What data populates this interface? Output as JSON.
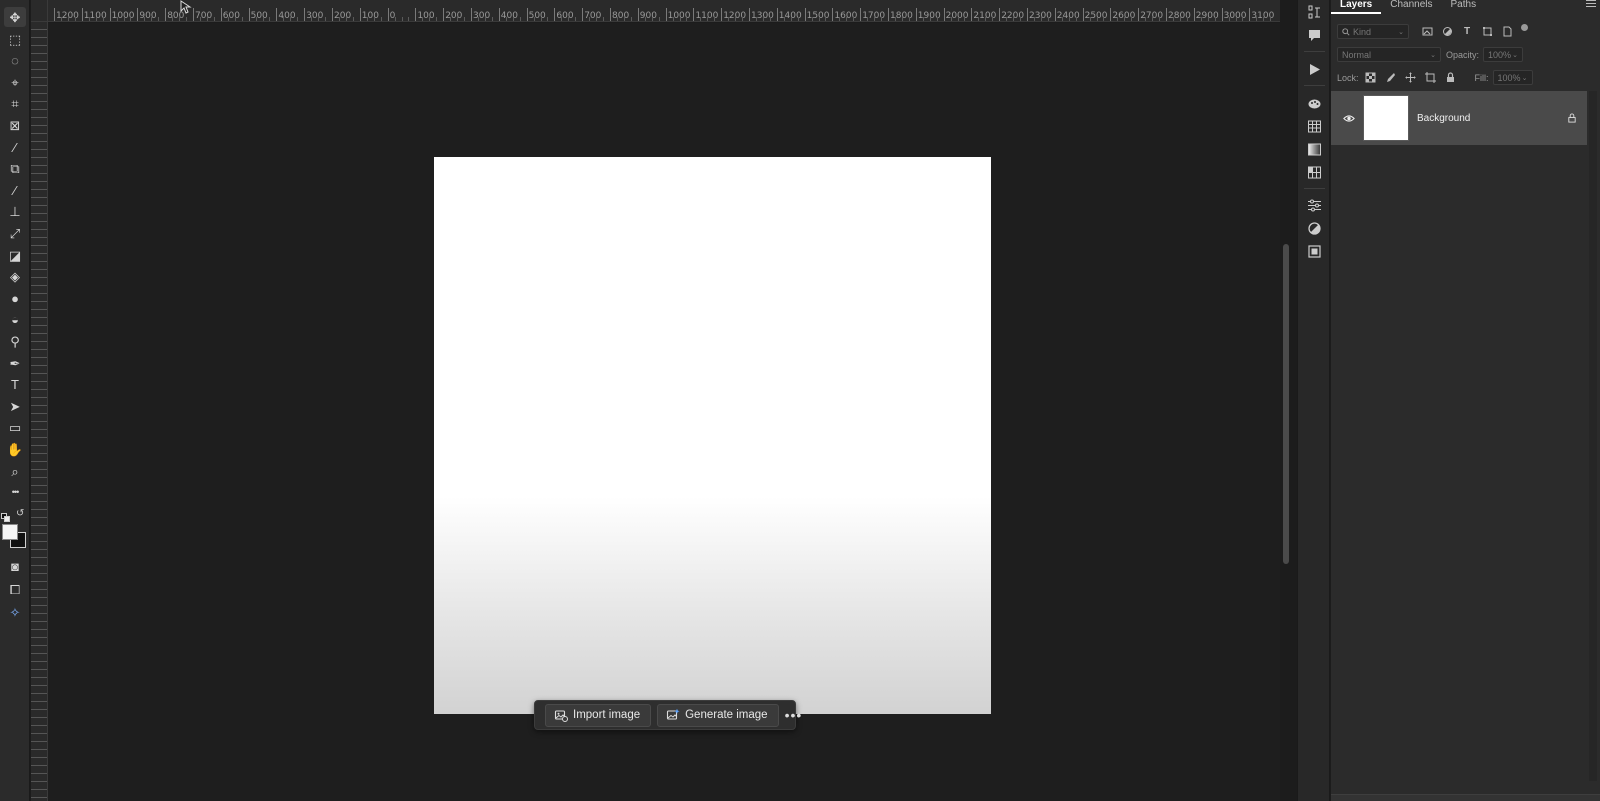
{
  "ruler": {
    "top_labels": [
      "1200",
      "1100",
      "1000",
      "900",
      "800",
      "700",
      "600",
      "500",
      "400",
      "300",
      "200",
      "100",
      "0",
      "100",
      "200",
      "300",
      "400",
      "500",
      "600",
      "700",
      "800",
      "900",
      "1000",
      "1100",
      "1200",
      "1300",
      "1400",
      "1500",
      "1600",
      "1700",
      "1800",
      "1900",
      "2000",
      "2100",
      "2200",
      "2300",
      "2400",
      "2500",
      "2600",
      "2700",
      "2800",
      "2900",
      "3000",
      "3100"
    ]
  },
  "toolbar": {
    "tools": [
      {
        "name": "move-tool",
        "icon": "move-icon",
        "glyph": "✥"
      },
      {
        "name": "marquee-tool",
        "icon": "rectangle-marquee-icon",
        "glyph": "⬚"
      },
      {
        "name": "lasso-tool",
        "icon": "lasso-icon",
        "glyph": "◌"
      },
      {
        "name": "quick-selection-tool",
        "icon": "quick-selection-icon",
        "glyph": "⌖"
      },
      {
        "name": "crop-tool",
        "icon": "crop-icon",
        "glyph": "⌗"
      },
      {
        "name": "frame-tool",
        "icon": "frame-icon",
        "glyph": "⊠"
      },
      {
        "name": "eyedropper-tool",
        "icon": "eyedropper-icon",
        "glyph": "⁄"
      },
      {
        "name": "spot-healing-tool",
        "icon": "bandage-icon",
        "glyph": "⧉"
      },
      {
        "name": "brush-tool",
        "icon": "brush-icon",
        "glyph": "∕"
      },
      {
        "name": "clone-stamp-tool",
        "icon": "stamp-icon",
        "glyph": "⊥"
      },
      {
        "name": "history-brush-tool",
        "icon": "history-brush-icon",
        "glyph": "⤢"
      },
      {
        "name": "eraser-tool",
        "icon": "eraser-icon",
        "glyph": "◪"
      },
      {
        "name": "paint-bucket-tool",
        "icon": "paint-bucket-icon",
        "glyph": "◈"
      },
      {
        "name": "blur-tool",
        "icon": "droplet-icon",
        "glyph": "●"
      },
      {
        "name": "dodge-tool",
        "icon": "smudge-icon",
        "glyph": "◒"
      },
      {
        "name": "zoom-dodge-tool",
        "icon": "dodge-icon",
        "glyph": "⚲"
      },
      {
        "name": "pen-tool",
        "icon": "pen-icon",
        "glyph": "✒"
      },
      {
        "name": "type-tool",
        "icon": "type-icon",
        "glyph": "T"
      },
      {
        "name": "path-selection-tool",
        "icon": "arrow-pointer-icon",
        "glyph": "➤"
      },
      {
        "name": "rectangle-tool",
        "icon": "rectangle-icon",
        "glyph": "▭"
      },
      {
        "name": "hand-tool",
        "icon": "hand-icon",
        "glyph": "✋"
      },
      {
        "name": "zoom-tool",
        "icon": "magnifier-icon",
        "glyph": "⌕"
      },
      {
        "name": "edit-toolbar",
        "icon": "more-icon",
        "glyph": "•••"
      }
    ],
    "bottom_tools": [
      {
        "name": "quick-mask-button",
        "icon": "quick-mask-icon",
        "glyph": "◙"
      },
      {
        "name": "screen-mode-button",
        "icon": "screen-mode-icon",
        "glyph": "⧠"
      },
      {
        "name": "generative-ai-button",
        "icon": "generative-icon",
        "glyph": "✧"
      }
    ]
  },
  "taskbar": {
    "import_label": "Import image",
    "generate_label": "Generate image",
    "more_label": "•••"
  },
  "dock": {
    "icons": [
      "history-icon",
      "comment-icon",
      "play-icon",
      "color-wheel-icon",
      "swatches-grid-icon",
      "gradient-icon",
      "patterns-icon",
      "adjustments-icon",
      "contrast-icon",
      "libraries-icon"
    ]
  },
  "panel": {
    "tabs": [
      "Layers",
      "Channels",
      "Paths"
    ],
    "filter": {
      "placeholder": "Kind"
    },
    "blend_mode": "Normal",
    "opacity_label": "Opacity:",
    "opacity_value": "100%",
    "lock_label": "Lock:",
    "fill_label": "Fill:",
    "fill_value": "100%",
    "layers": [
      {
        "name": "Background",
        "visible": true,
        "locked": true,
        "thumb_color": "#ffffff"
      }
    ]
  },
  "colors": {
    "foreground": "#f5f5f5",
    "background": "#111111",
    "canvas_bg": "#1e1e1e",
    "accent": "#4a4a4a"
  }
}
